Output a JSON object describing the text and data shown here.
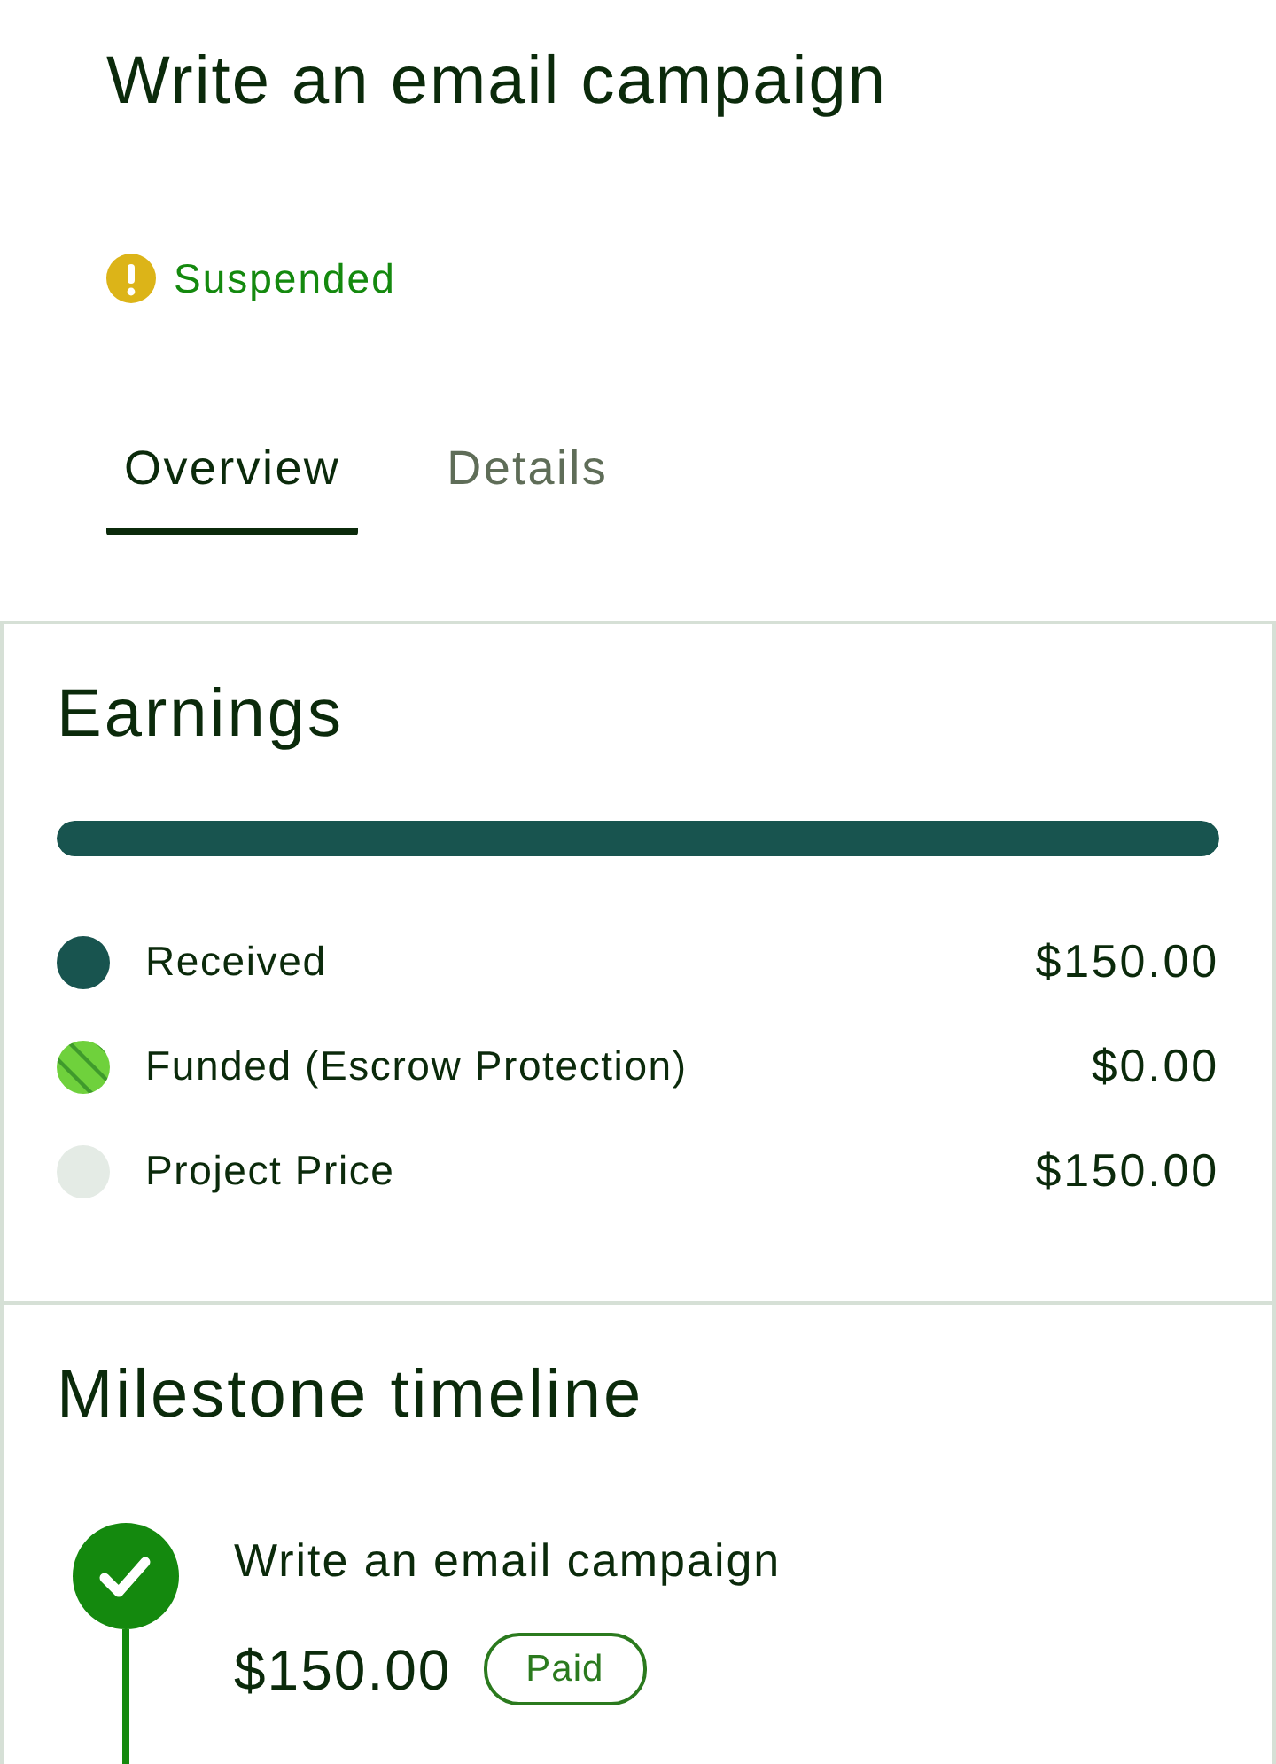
{
  "page": {
    "title": "Write an email campaign",
    "status": {
      "label": "Suspended",
      "kind": "warning"
    }
  },
  "tabs": [
    {
      "label": "Overview",
      "selected": true
    },
    {
      "label": "Details",
      "selected": false
    }
  ],
  "earnings": {
    "title": "Earnings",
    "progress": {
      "level": 1
    },
    "legend": [
      {
        "label": "Received",
        "amount": "$150.00",
        "color": "#18544f",
        "kind": "solid"
      },
      {
        "label": "Funded (Escrow Protection)",
        "amount": "$0.00",
        "color": "#6fd13c",
        "kind": "striped"
      },
      {
        "label": "Project Price",
        "amount": "$150.00",
        "color": "#e4ebe5",
        "kind": "solid"
      }
    ]
  },
  "milestone_timeline": {
    "title": "Milestone timeline",
    "milestones": [
      {
        "title": "Write an email campaign",
        "amount": "$150.00",
        "status": "Paid",
        "completed": true
      }
    ]
  }
}
